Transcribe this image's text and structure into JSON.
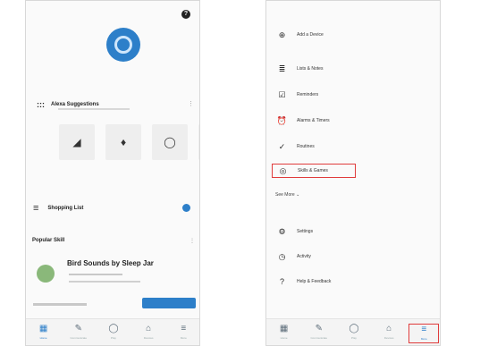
{
  "left_screen": {
    "status": {
      "left": "",
      "center": "",
      "right": ""
    },
    "help_icon": "?",
    "greeting": "",
    "suggestions": {
      "icon": ":::",
      "title": "Alexa Suggestions"
    },
    "devices": [
      {
        "icon": "speaker-icon",
        "glyph": "◢",
        "label": ""
      },
      {
        "icon": "lightbulb-icon",
        "glyph": "♦",
        "label": ""
      },
      {
        "icon": "alexa-ring-icon",
        "glyph": "◯",
        "label": ""
      },
      {
        "icon": "phone-icon",
        "glyph": "▮",
        "label": ""
      }
    ],
    "shopping_list": {
      "icon": "≡",
      "title": "Shopping List"
    },
    "popular_skill": {
      "title": "Popular Skill",
      "menu": "⋮"
    },
    "skill": {
      "title": "Bird Sounds by Sleep Jar"
    }
  },
  "right_screen": {
    "status": {
      "left": "",
      "center": "",
      "right": ""
    },
    "menu_items": [
      {
        "icon": "plus-circle-icon",
        "glyph": "⊕",
        "label": "Add a Device"
      },
      {
        "icon": "list-icon",
        "glyph": "≣",
        "label": "Lists & Notes"
      },
      {
        "icon": "reminder-icon",
        "glyph": "☑",
        "label": "Reminders"
      },
      {
        "icon": "alarm-icon",
        "glyph": "⏰",
        "label": "Alarms & Timers"
      },
      {
        "icon": "routine-icon",
        "glyph": "✓",
        "label": "Routines"
      },
      {
        "icon": "skills-icon",
        "glyph": "◎",
        "label": "Skills & Games"
      }
    ],
    "see_more": "See More ⌄",
    "lower_items": [
      {
        "icon": "gear-icon",
        "glyph": "⚙",
        "label": "Settings"
      },
      {
        "icon": "activity-icon",
        "glyph": "◷",
        "label": "Activity"
      },
      {
        "icon": "help-icon",
        "glyph": "?",
        "label": "Help & Feedback"
      }
    ]
  },
  "tabs": [
    {
      "icon": "home-icon",
      "glyph": "▦",
      "label": "Home"
    },
    {
      "icon": "communicate-icon",
      "glyph": "✎",
      "label": "Communicate"
    },
    {
      "icon": "play-icon",
      "glyph": "◯",
      "label": "Play"
    },
    {
      "icon": "devices-icon",
      "glyph": "⌂",
      "label": "Devices"
    },
    {
      "icon": "more-icon",
      "glyph": "≡",
      "label": "More"
    }
  ],
  "colors": {
    "accent": "#2d7fc9",
    "highlight": "#e03b3b"
  }
}
